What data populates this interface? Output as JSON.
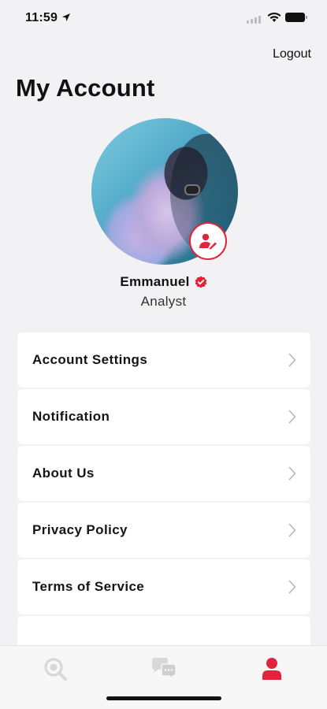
{
  "status_bar": {
    "time": "11:59"
  },
  "header": {
    "logout_label": "Logout",
    "title": "My Account"
  },
  "profile": {
    "name": "Emmanuel",
    "role": "Analyst"
  },
  "menu": {
    "items": [
      {
        "label": "Account Settings"
      },
      {
        "label": "Notification"
      },
      {
        "label": "About Us"
      },
      {
        "label": "Privacy Policy"
      },
      {
        "label": "Terms of Service"
      }
    ]
  },
  "tab_bar": {
    "tabs": [
      {
        "icon": "search-icon",
        "active": false
      },
      {
        "icon": "chat-icon",
        "active": false
      },
      {
        "icon": "profile-icon",
        "active": true
      }
    ]
  },
  "colors": {
    "accent": "#e0243c",
    "inactive_icon": "#d8d8da",
    "background": "#f2f2f4"
  }
}
